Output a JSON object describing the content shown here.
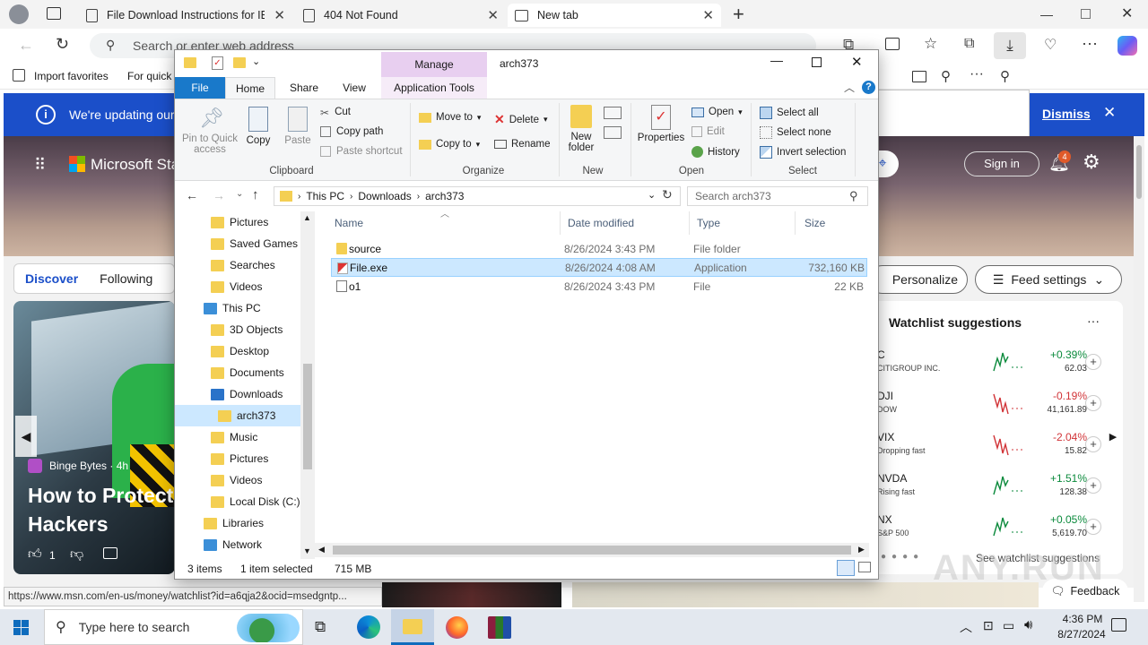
{
  "browser": {
    "tabs": [
      {
        "title": "File Download Instructions for IE",
        "active": false
      },
      {
        "title": "404 Not Found",
        "active": false
      },
      {
        "title": "New tab",
        "active": true
      }
    ],
    "address_placeholder": "Search or enter web address",
    "favorites": {
      "import": "Import favorites",
      "quick": "For quick"
    },
    "update_banner": {
      "text": "We're updating our",
      "dismiss": "Dismiss"
    },
    "status_url": "https://www.msn.com/en-us/money/watchlist?id=a6qja2&ocid=msedgntp..."
  },
  "msn": {
    "brand": "Microsoft Sta",
    "sign_in": "Sign in",
    "notif_count": "4",
    "feed_tabs": {
      "discover": "Discover",
      "following": "Following"
    },
    "personalize": "Personalize",
    "feed_settings": "Feed settings",
    "news": {
      "source": "Binge Bytes · 4h",
      "headline_line1": "How to Protect",
      "headline_line2": "Hackers",
      "likes": "1"
    },
    "watchlist": {
      "title": "Watchlist suggestions",
      "see_more": "See watchlist suggestions",
      "stocks": [
        {
          "ticker": "C",
          "name": "CITIGROUP INC.",
          "change": "+0.39%",
          "price": "62.03",
          "color": "#0b8a3c"
        },
        {
          "ticker": "DJI",
          "name": "DOW",
          "change": "-0.19%",
          "price": "41,161.89",
          "color": "#d13438"
        },
        {
          "ticker": "VIX",
          "name": "Dropping fast",
          "change": "-2.04%",
          "price": "15.82",
          "color": "#d13438"
        },
        {
          "ticker": "NVDA",
          "name": "Rising fast",
          "change": "+1.51%",
          "price": "128.38",
          "color": "#0b8a3c"
        },
        {
          "ticker": "NX",
          "name": "S&P 500",
          "change": "+0.05%",
          "price": "5,619.70",
          "color": "#0b8a3c"
        }
      ]
    },
    "feedback": "Feedback"
  },
  "explorer": {
    "title": "arch373",
    "manage": "Manage",
    "ribbon_tabs": [
      "File",
      "Home",
      "Share",
      "View",
      "Application Tools"
    ],
    "clipboard": {
      "pin": "Pin to Quick access",
      "copy": "Copy",
      "paste": "Paste",
      "cut": "Cut",
      "copy_path": "Copy path",
      "paste_shortcut": "Paste shortcut",
      "label": "Clipboard"
    },
    "organize": {
      "move_to": "Move to",
      "copy_to": "Copy to",
      "delete": "Delete",
      "rename": "Rename",
      "label": "Organize"
    },
    "new": {
      "new_folder": "New folder",
      "label": "New"
    },
    "open": {
      "properties": "Properties",
      "open": "Open",
      "edit": "Edit",
      "history": "History",
      "label": "Open"
    },
    "select": {
      "select_all": "Select all",
      "select_none": "Select none",
      "invert": "Invert selection",
      "label": "Select"
    },
    "breadcrumb": [
      "This PC",
      "Downloads",
      "arch373"
    ],
    "search_placeholder": "Search arch373",
    "tree": [
      {
        "label": "Pictures",
        "indent": 1
      },
      {
        "label": "Saved Games",
        "indent": 1
      },
      {
        "label": "Searches",
        "indent": 1
      },
      {
        "label": "Videos",
        "indent": 1
      },
      {
        "label": "This PC",
        "indent": 0
      },
      {
        "label": "3D Objects",
        "indent": 1
      },
      {
        "label": "Desktop",
        "indent": 1
      },
      {
        "label": "Documents",
        "indent": 1
      },
      {
        "label": "Downloads",
        "indent": 1
      },
      {
        "label": "arch373",
        "indent": 2,
        "selected": true
      },
      {
        "label": "Music",
        "indent": 1
      },
      {
        "label": "Pictures",
        "indent": 1
      },
      {
        "label": "Videos",
        "indent": 1
      },
      {
        "label": "Local Disk (C:)",
        "indent": 1
      },
      {
        "label": "Libraries",
        "indent": 0
      },
      {
        "label": "Network",
        "indent": 0
      }
    ],
    "columns": {
      "name": "Name",
      "date": "Date modified",
      "type": "Type",
      "size": "Size"
    },
    "files": [
      {
        "name": "source",
        "date": "8/26/2024 3:43 PM",
        "type": "File folder",
        "size": "",
        "icon": "folder-icon"
      },
      {
        "name": "File.exe",
        "date": "8/26/2024 4:08 AM",
        "type": "Application",
        "size": "732,160 KB",
        "icon": "exe-icon",
        "selected": true
      },
      {
        "name": "o1",
        "date": "8/26/2024 3:43 PM",
        "type": "File",
        "size": "22 KB",
        "icon": "file-icon"
      }
    ],
    "status": {
      "items": "3 items",
      "selected": "1 item selected",
      "size": "715 MB"
    }
  },
  "taskbar": {
    "search_placeholder": "Type here to search",
    "time": "4:36 PM",
    "date": "8/27/2024"
  },
  "watermark": "ANY.RUN"
}
